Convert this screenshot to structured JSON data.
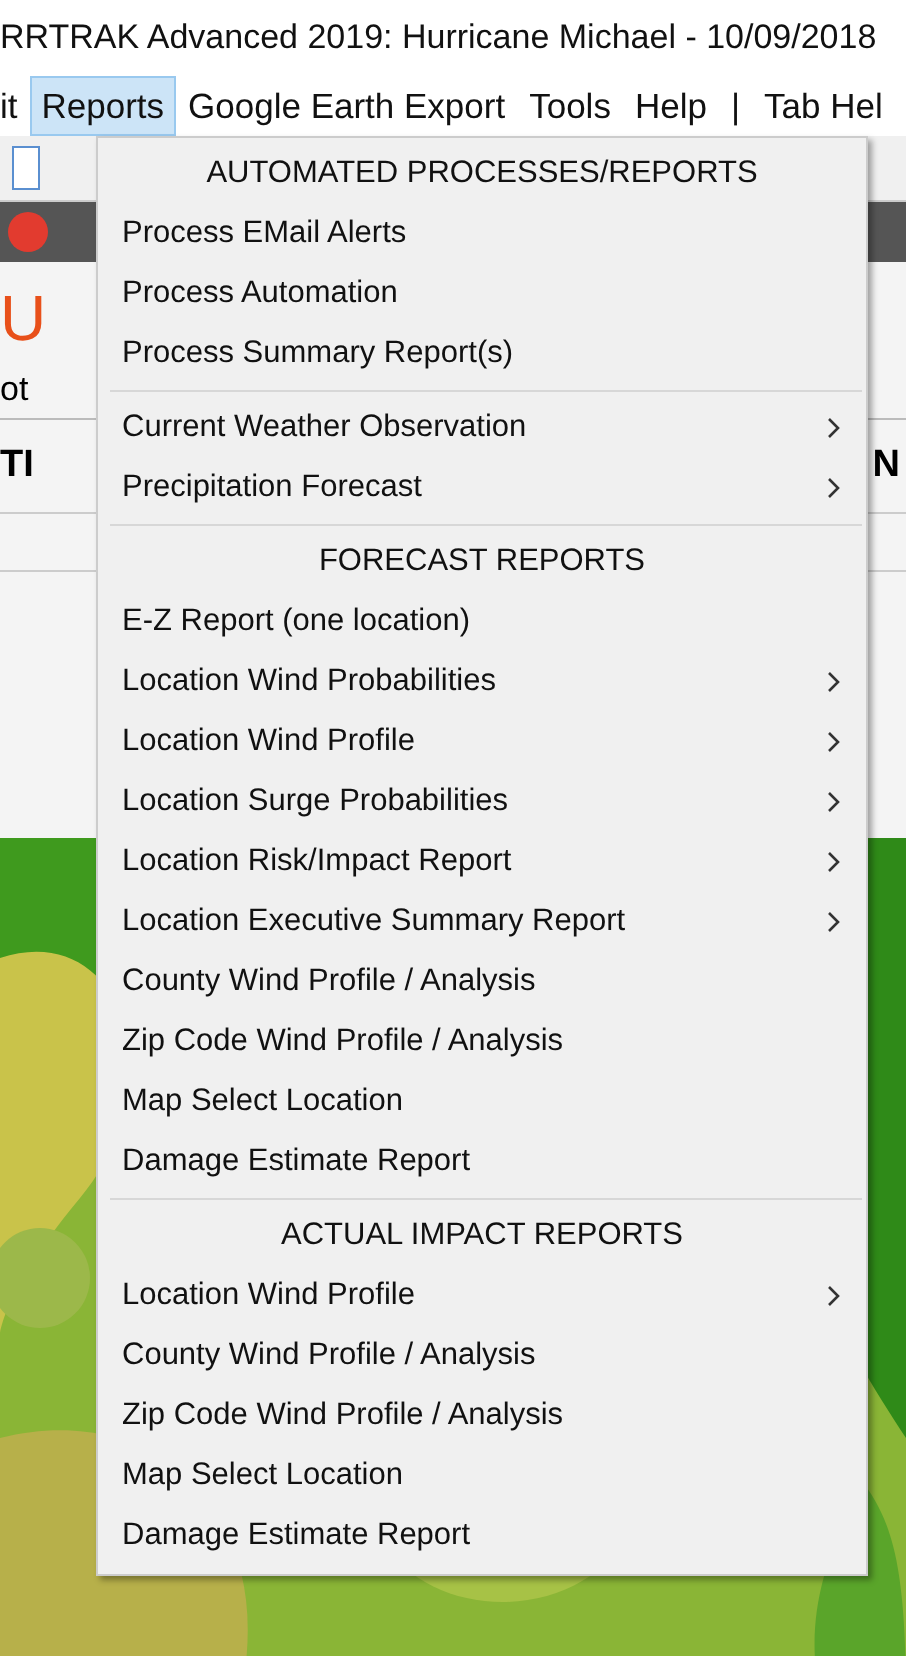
{
  "window": {
    "title": "RRTRAK Advanced 2019: Hurricane Michael - 10/09/2018"
  },
  "menubar": [
    {
      "label": "it",
      "selected": false
    },
    {
      "label": "Reports",
      "selected": true
    },
    {
      "label": "Google Earth Export",
      "selected": false
    },
    {
      "label": "Tools",
      "selected": false
    },
    {
      "label": "Help",
      "selected": false
    },
    {
      "label": "|",
      "selected": false
    },
    {
      "label": "Tab Hel",
      "selected": false
    }
  ],
  "background": {
    "title_fragment": "U",
    "subtitle_fragment": "ot",
    "left_heading_fragment": "TI",
    "right_heading_fragment": "N"
  },
  "menu": [
    {
      "kind": "header",
      "label": "AUTOMATED PROCESSES/REPORTS"
    },
    {
      "kind": "item",
      "label": "Process EMail Alerts",
      "submenu": false
    },
    {
      "kind": "item",
      "label": "Process Automation",
      "submenu": false
    },
    {
      "kind": "item",
      "label": "Process Summary Report(s)",
      "submenu": false
    },
    {
      "kind": "separator"
    },
    {
      "kind": "item",
      "label": "Current Weather Observation",
      "submenu": true
    },
    {
      "kind": "item",
      "label": "Precipitation Forecast",
      "submenu": true
    },
    {
      "kind": "separator"
    },
    {
      "kind": "header",
      "label": "FORECAST REPORTS"
    },
    {
      "kind": "item",
      "label": "E-Z Report (one location)",
      "submenu": false
    },
    {
      "kind": "item",
      "label": "Location Wind Probabilities",
      "submenu": true
    },
    {
      "kind": "item",
      "label": "Location Wind Profile",
      "submenu": true
    },
    {
      "kind": "item",
      "label": "Location Surge Probabilities",
      "submenu": true
    },
    {
      "kind": "item",
      "label": "Location Risk/Impact Report",
      "submenu": true
    },
    {
      "kind": "item",
      "label": "Location Executive Summary Report",
      "submenu": true
    },
    {
      "kind": "item",
      "label": "County Wind Profile / Analysis",
      "submenu": false
    },
    {
      "kind": "item",
      "label": "Zip Code Wind Profile / Analysis",
      "submenu": false
    },
    {
      "kind": "item",
      "label": "Map Select Location",
      "submenu": false
    },
    {
      "kind": "item",
      "label": "Damage Estimate Report",
      "submenu": false
    },
    {
      "kind": "separator"
    },
    {
      "kind": "header",
      "label": "ACTUAL IMPACT REPORTS"
    },
    {
      "kind": "item",
      "label": "Location Wind Profile",
      "submenu": true
    },
    {
      "kind": "item",
      "label": "County Wind Profile / Analysis",
      "submenu": false
    },
    {
      "kind": "item",
      "label": "Zip Code Wind Profile / Analysis",
      "submenu": false
    },
    {
      "kind": "item",
      "label": "Map Select Location",
      "submenu": false
    },
    {
      "kind": "item",
      "label": "Damage Estimate Report",
      "submenu": false
    }
  ]
}
